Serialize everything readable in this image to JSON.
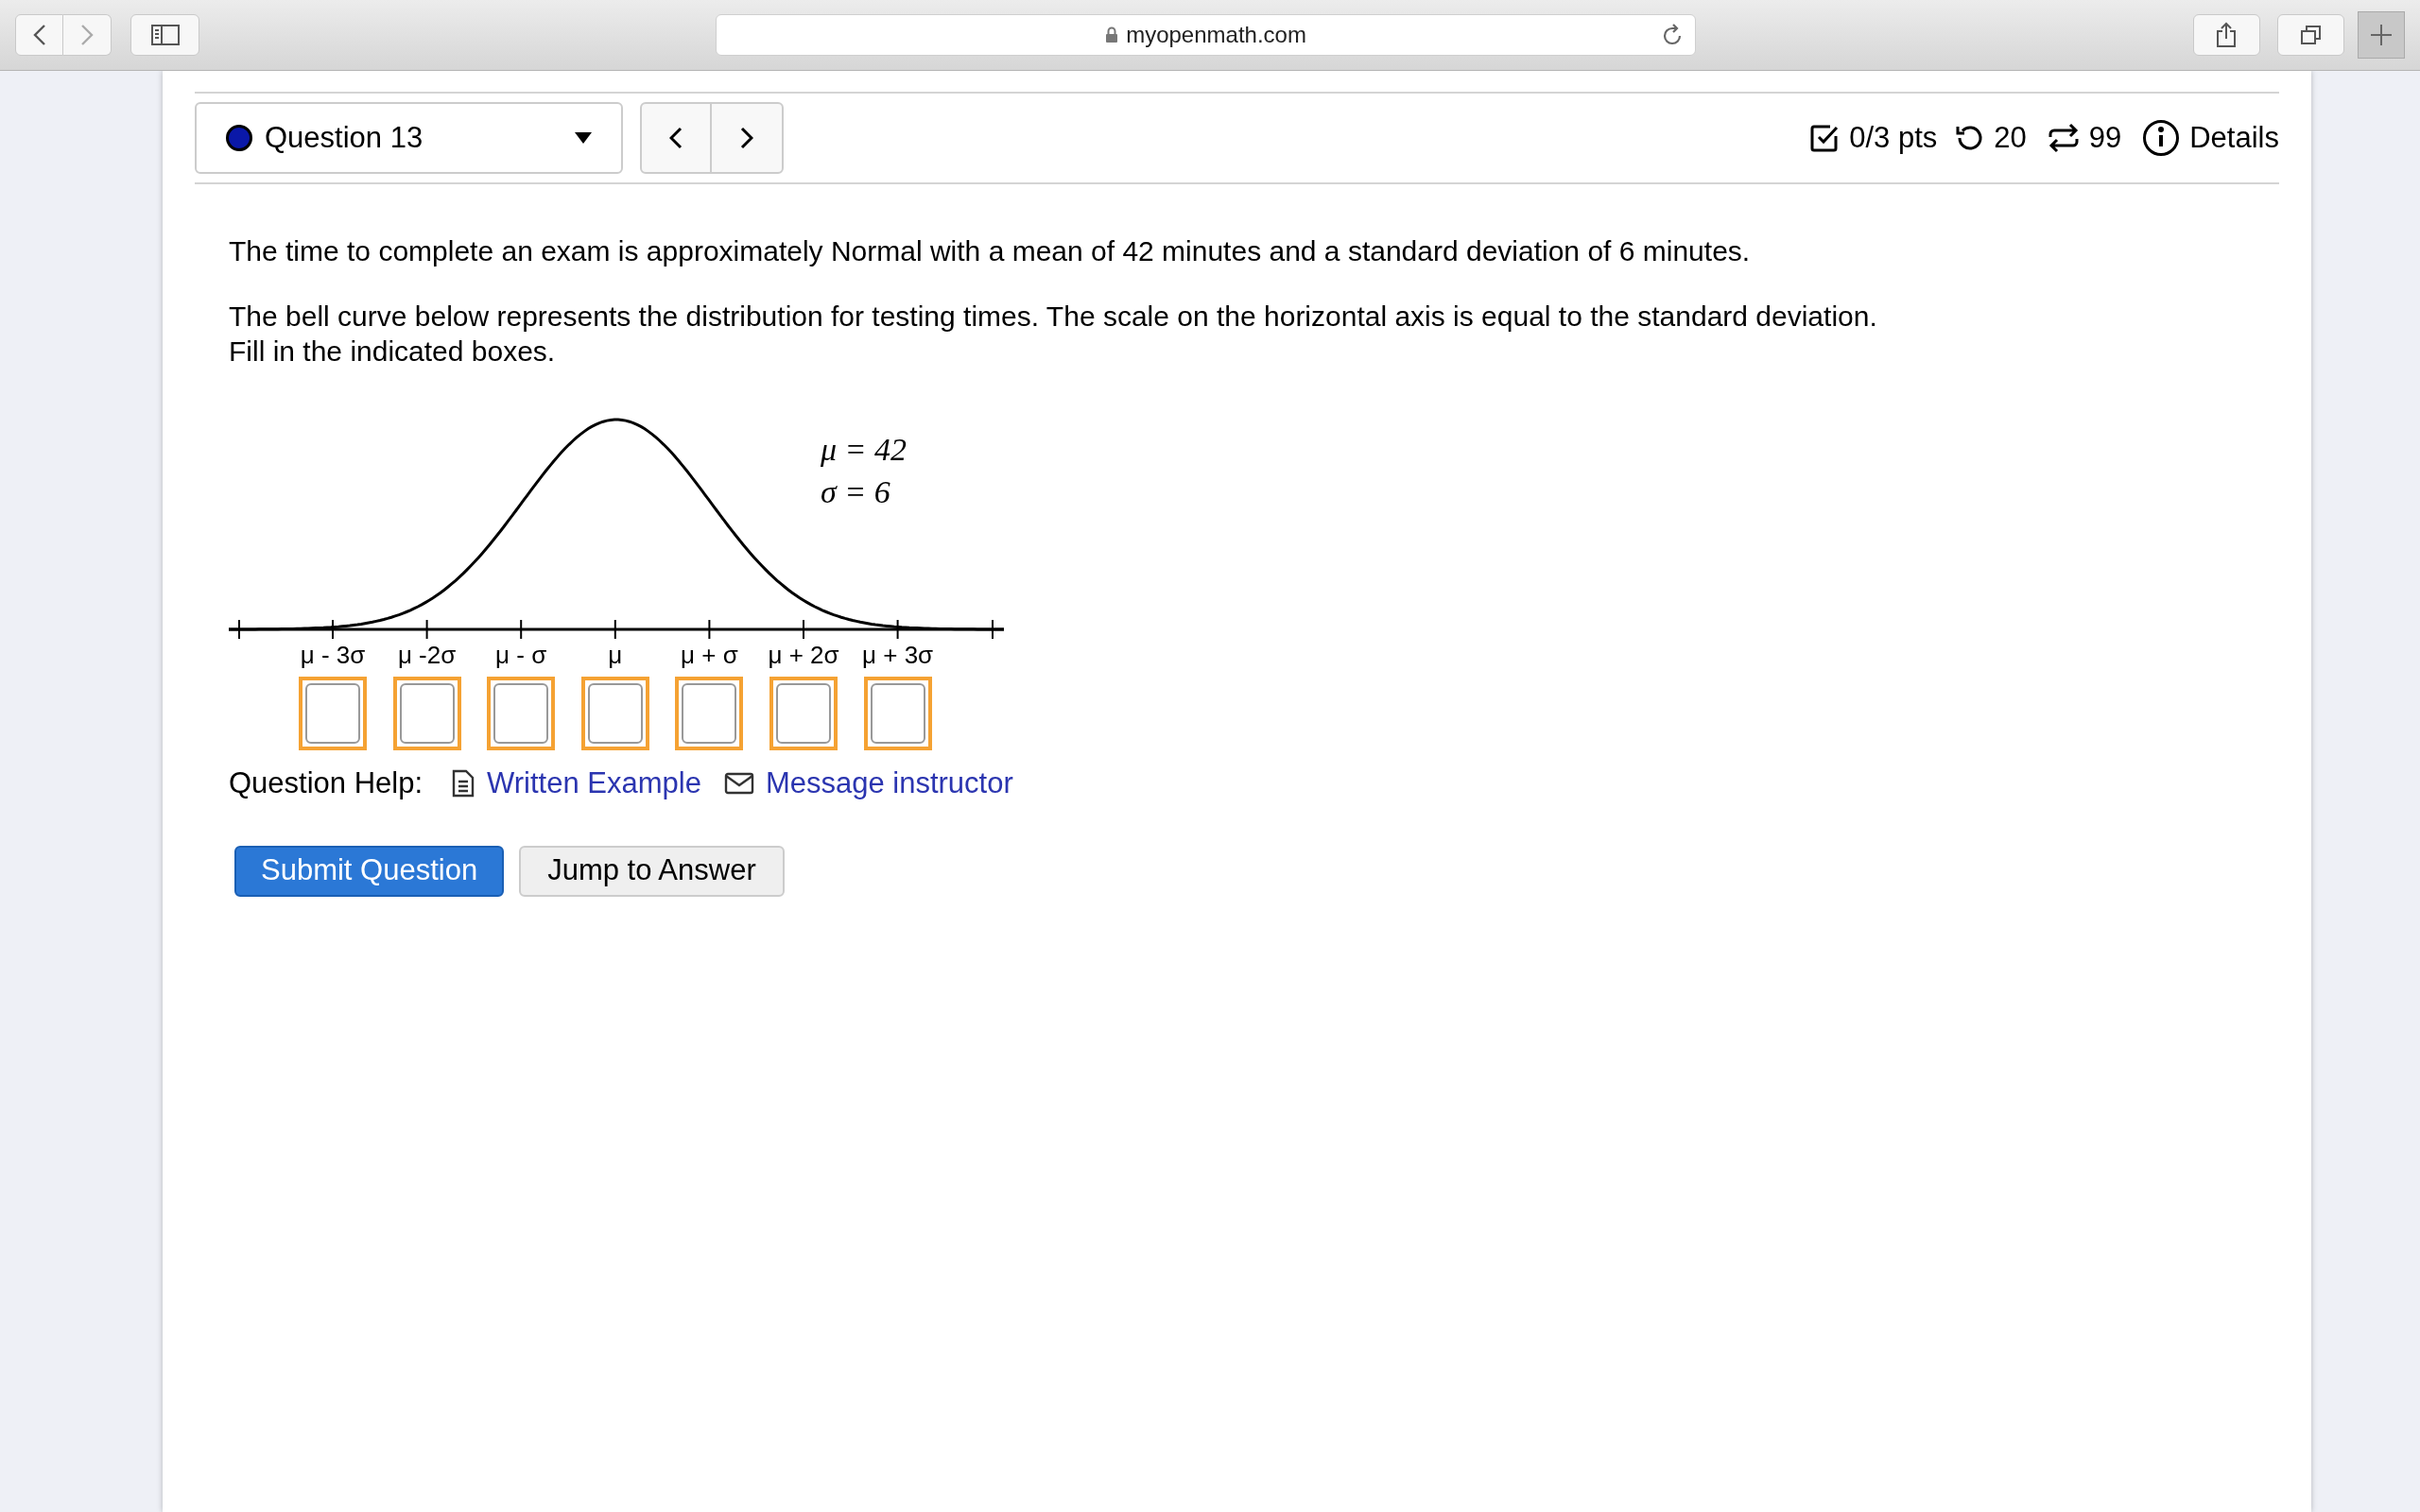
{
  "browser": {
    "url": "myopenmath.com"
  },
  "question_header": {
    "question_select": "Question 13",
    "score": "0/3 pts",
    "retries": "20",
    "attempts": "99",
    "details": "Details"
  },
  "question_text": [
    "The time to complete an exam is approximately Normal with a mean of 42 minutes and a standard deviation of 6 minutes.",
    "The bell curve below represents the distribution for testing times. The scale on the horizontal axis is equal to the standard deviation. Fill in the indicated boxes."
  ],
  "bell_curve": {
    "parameters": [
      "μ = 42",
      "σ = 6"
    ],
    "ticks": [
      {
        "label": "μ - 3σ"
      },
      {
        "label": "μ -2σ"
      },
      {
        "label": "μ - σ"
      },
      {
        "label": "μ"
      },
      {
        "label": "μ + σ"
      },
      {
        "label": "μ + 2σ"
      },
      {
        "label": "μ + 3σ"
      }
    ]
  },
  "question_help": {
    "label": "Question Help:",
    "links": [
      {
        "kind": "document",
        "text": "Written Example"
      },
      {
        "kind": "mail",
        "text": "Message instructor"
      }
    ]
  },
  "buttons": [
    {
      "kind": "primary",
      "text": "Submit Question"
    },
    {
      "kind": "secondary",
      "text": "Jump to Answer"
    }
  ]
}
